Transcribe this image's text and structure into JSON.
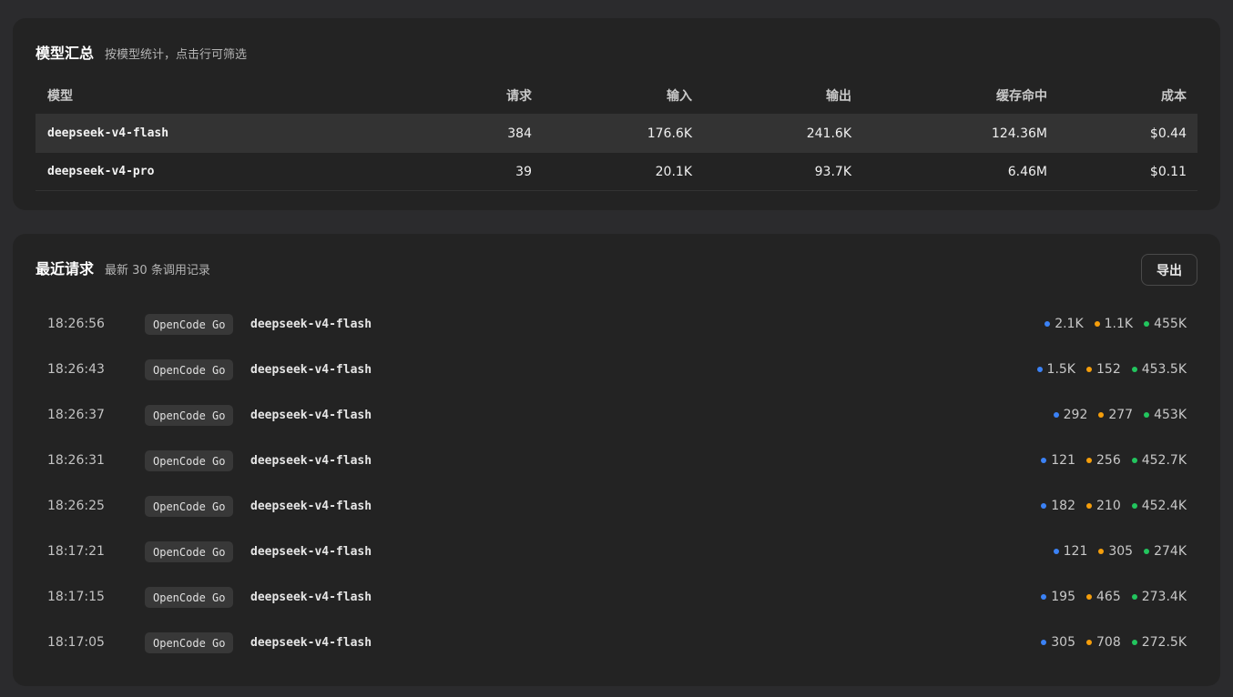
{
  "colors": {
    "input_dot": "#3b82f6",
    "output_dot": "#f59e0b",
    "cache_dot": "#22c55e"
  },
  "summary": {
    "title": "模型汇总",
    "subtitle": "按模型统计，点击行可筛选",
    "columns": {
      "model": "模型",
      "requests": "请求",
      "input": "输入",
      "output": "输出",
      "cache_hit": "缓存命中",
      "cost": "成本"
    },
    "rows": [
      {
        "model": "deepseek-v4-flash",
        "requests": "384",
        "input": "176.6K",
        "output": "241.6K",
        "cache_hit": "124.36M",
        "cost": "$0.44"
      },
      {
        "model": "deepseek-v4-pro",
        "requests": "39",
        "input": "20.1K",
        "output": "93.7K",
        "cache_hit": "6.46M",
        "cost": "$0.11"
      }
    ]
  },
  "recent": {
    "title": "最近请求",
    "subtitle": "最新 30 条调用记录",
    "export_label": "导出",
    "rows": [
      {
        "time": "18:26:56",
        "provider": "OpenCode Go",
        "model": "deepseek-v4-flash",
        "input": "2.1K",
        "output": "1.1K",
        "cache": "455K"
      },
      {
        "time": "18:26:43",
        "provider": "OpenCode Go",
        "model": "deepseek-v4-flash",
        "input": "1.5K",
        "output": "152",
        "cache": "453.5K"
      },
      {
        "time": "18:26:37",
        "provider": "OpenCode Go",
        "model": "deepseek-v4-flash",
        "input": "292",
        "output": "277",
        "cache": "453K"
      },
      {
        "time": "18:26:31",
        "provider": "OpenCode Go",
        "model": "deepseek-v4-flash",
        "input": "121",
        "output": "256",
        "cache": "452.7K"
      },
      {
        "time": "18:26:25",
        "provider": "OpenCode Go",
        "model": "deepseek-v4-flash",
        "input": "182",
        "output": "210",
        "cache": "452.4K"
      },
      {
        "time": "18:17:21",
        "provider": "OpenCode Go",
        "model": "deepseek-v4-flash",
        "input": "121",
        "output": "305",
        "cache": "274K"
      },
      {
        "time": "18:17:15",
        "provider": "OpenCode Go",
        "model": "deepseek-v4-flash",
        "input": "195",
        "output": "465",
        "cache": "273.4K"
      },
      {
        "time": "18:17:05",
        "provider": "OpenCode Go",
        "model": "deepseek-v4-flash",
        "input": "305",
        "output": "708",
        "cache": "272.5K"
      }
    ]
  }
}
